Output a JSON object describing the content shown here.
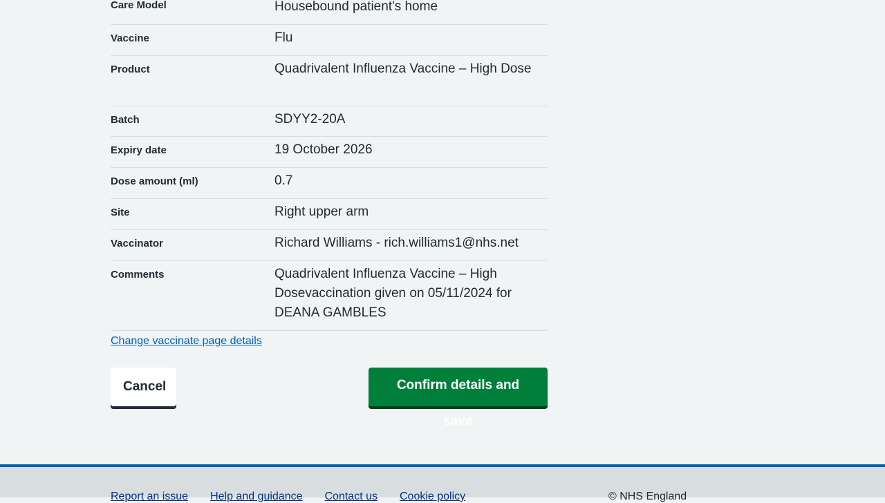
{
  "summary": {
    "rows": [
      {
        "key": "Care Model",
        "value": "Housebound patient's home"
      },
      {
        "key": "Vaccine",
        "value": "Flu"
      },
      {
        "key": "Product",
        "value": "Quadrivalent Influenza Vaccine – High Dose"
      },
      {
        "key": "Batch",
        "value": "SDYY2-20A"
      },
      {
        "key": "Expiry date",
        "value": "19 October 2026"
      },
      {
        "key": "Dose amount (ml)",
        "value": "0.7"
      },
      {
        "key": "Site",
        "value": "Right upper arm"
      },
      {
        "key": "Vaccinator",
        "value": "Richard Williams - rich.williams1@nhs.net"
      },
      {
        "key": "Comments",
        "value": "Quadrivalent Influenza Vaccine – High Dosevaccination given on 05/11/2024 for DEANA GAMBLES"
      }
    ]
  },
  "change_link": "Change vaccinate page details",
  "buttons": {
    "cancel": "Cancel",
    "confirm": "Confirm details and save"
  },
  "footer": {
    "links": [
      "Report an issue",
      "Help and guidance",
      "Contact us",
      "Cookie policy"
    ],
    "copyright": "© NHS England"
  },
  "colors": {
    "background": "#f0f4f5",
    "link": "#005eb8",
    "confirm_button": "#007f3b",
    "footer_border": "#005eb8",
    "footer_background": "#d8dde0"
  }
}
